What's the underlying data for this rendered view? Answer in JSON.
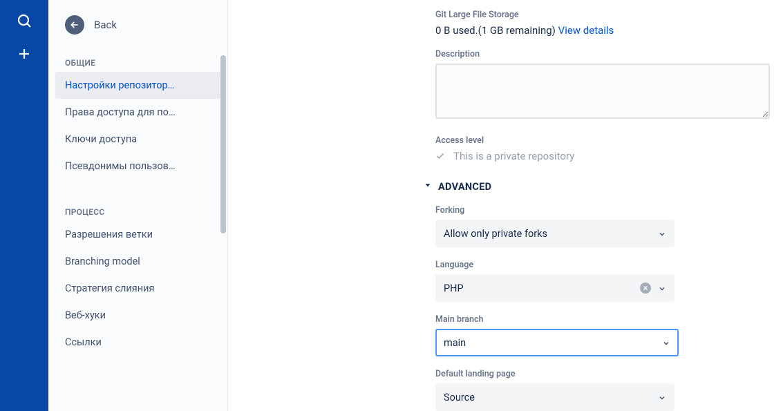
{
  "rail": {
    "search": "search",
    "create": "create"
  },
  "sidebar": {
    "back_label": "Back",
    "sections": [
      {
        "header": "ОБЩИЕ",
        "items": [
          "Настройки репозитор…",
          "Права доступа для по…",
          "Ключи доступа",
          "Псевдонимы пользов…"
        ],
        "active_index": 0
      },
      {
        "header": "ПРОЦЕСС",
        "items": [
          "Разрешения ветки",
          "Branching model",
          "Стратегия слияния",
          "Веб-хуки",
          "Ссылки"
        ],
        "active_index": -1
      }
    ]
  },
  "main": {
    "storage_label": "Git Large File Storage",
    "storage_used": "0 B used.",
    "storage_remaining": "(1 GB remaining)",
    "view_details": "View details",
    "description_label": "Description",
    "description_value": "",
    "access_level_label": "Access level",
    "access_level_text": "This is a private repository",
    "advanced_header": "ADVANCED",
    "forking_label": "Forking",
    "forking_value": "Allow only private forks",
    "language_label": "Language",
    "language_value": "PHP",
    "main_branch_label": "Main branch",
    "main_branch_value": "main",
    "landing_label": "Default landing page",
    "landing_value": "Source"
  }
}
